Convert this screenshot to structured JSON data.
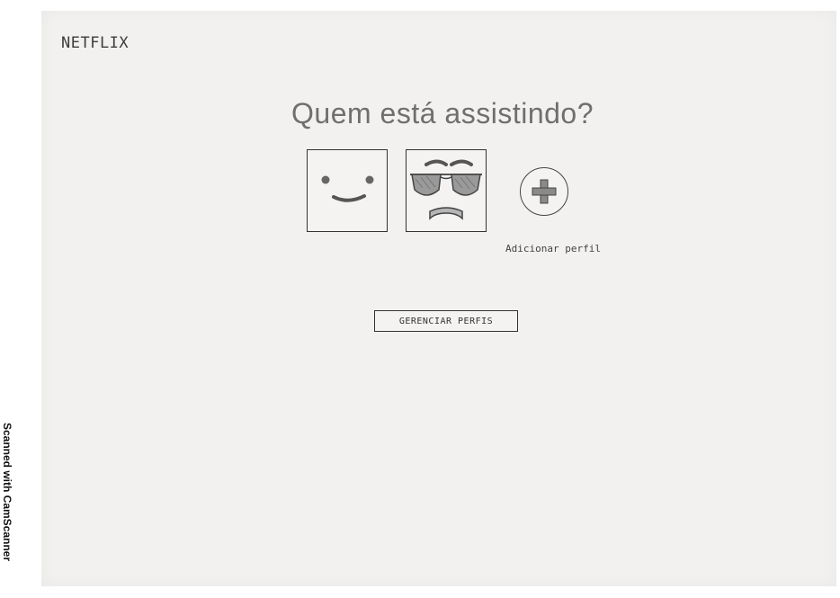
{
  "header": {
    "logo_text": "NETFLIX"
  },
  "main": {
    "title": "Quem está assistindo?",
    "profiles": [
      {
        "name": "",
        "avatar_icon": "smiley-face-icon"
      },
      {
        "name": "",
        "avatar_icon": "sunglasses-face-icon"
      }
    ],
    "add_profile": {
      "label": "Adicionar perfil",
      "icon": "plus-circle-icon"
    },
    "manage_button_label": "GERENCIAR PERFIS"
  },
  "scanner_watermark": "Scanned with CamScanner",
  "colors": {
    "paper": "#f2f1ef",
    "ink": "#333333",
    "title_gray": "#6f6f6f"
  }
}
